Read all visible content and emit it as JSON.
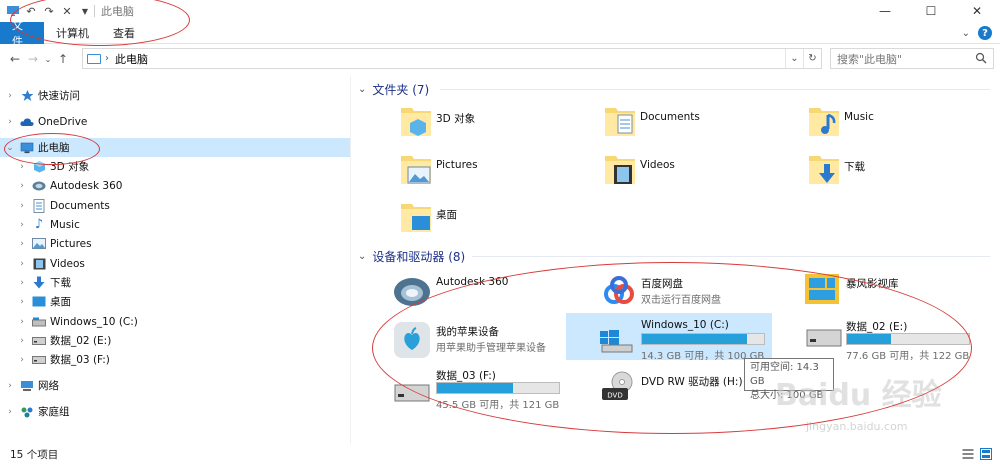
{
  "window": {
    "title": "此电脑",
    "qat_icons": [
      "pc-icon",
      "undo-icon",
      "redo-icon",
      "delete-icon",
      "dropdown-icon"
    ],
    "controls": [
      "minimize-icon",
      "maximize-icon",
      "close-icon"
    ]
  },
  "ribbon": {
    "tabs": [
      "文件",
      "计算机",
      "查看"
    ],
    "accent": "#1979ca"
  },
  "nav": {
    "breadcrumb": "此电脑",
    "search_placeholder": "搜索\"此电脑\""
  },
  "sidebar": {
    "items": [
      {
        "label": "快速访问",
        "icon": "star-icon",
        "expanded": false
      },
      {
        "label": "OneDrive",
        "icon": "cloud-icon",
        "expanded": false
      },
      {
        "label": "此电脑",
        "icon": "pc-icon",
        "expanded": true,
        "selected": true
      },
      {
        "label": "3D 对象",
        "icon": "cube-icon"
      },
      {
        "label": "Autodesk 360",
        "icon": "autodesk-icon"
      },
      {
        "label": "Documents",
        "icon": "document-icon"
      },
      {
        "label": "Music",
        "icon": "music-icon"
      },
      {
        "label": "Pictures",
        "icon": "picture-icon"
      },
      {
        "label": "Videos",
        "icon": "video-icon"
      },
      {
        "label": "下载",
        "icon": "download-icon"
      },
      {
        "label": "桌面",
        "icon": "desktop-icon"
      },
      {
        "label": "Windows_10 (C:)",
        "icon": "drive-icon"
      },
      {
        "label": "数据_02 (E:)",
        "icon": "drive-icon"
      },
      {
        "label": "数据_03 (F:)",
        "icon": "drive-icon"
      },
      {
        "label": "网络",
        "icon": "network-icon"
      },
      {
        "label": "家庭组",
        "icon": "homegroup-icon"
      }
    ]
  },
  "content": {
    "folders_header": "文件夹 (7)",
    "folders": [
      "3D 对象",
      "Documents",
      "Music",
      "Pictures",
      "Videos",
      "下载",
      "桌面"
    ],
    "devices_header": "设备和驱动器 (8)",
    "apps": [
      {
        "name": "Autodesk 360",
        "sub": ""
      },
      {
        "name": "百度网盘",
        "sub": "双击运行百度网盘"
      },
      {
        "name": "暴风影视库",
        "sub": ""
      },
      {
        "name": "我的苹果设备",
        "sub": "用苹果助手管理苹果设备"
      },
      {
        "name": "DVD RW 驱动器 (H:)",
        "sub": ""
      }
    ],
    "drives": [
      {
        "name": "Windows_10 (C:)",
        "size": "14.3 GB 可用，共 100 GB",
        "used_fraction": 0.857
      },
      {
        "name": "数据_02 (E:)",
        "size": "77.6 GB 可用，共 122 GB",
        "used_fraction": 0.364
      },
      {
        "name": "数据_03 (F:)",
        "size": "45.5 GB 可用，共 121 GB",
        "used_fraction": 0.624
      }
    ],
    "tooltip": {
      "line1": "可用空间: 14.3 GB",
      "line2": "总大小: 100 GB"
    }
  },
  "status": {
    "count": "15 个项目"
  },
  "watermark": {
    "text": "Baidu 经验",
    "url": "jingyan.baidu.com"
  },
  "colors": {
    "selection": "#cce8ff",
    "bar_fill": "#26a0da",
    "annotation": "#d63b3b",
    "header_text": "#1e3287"
  }
}
